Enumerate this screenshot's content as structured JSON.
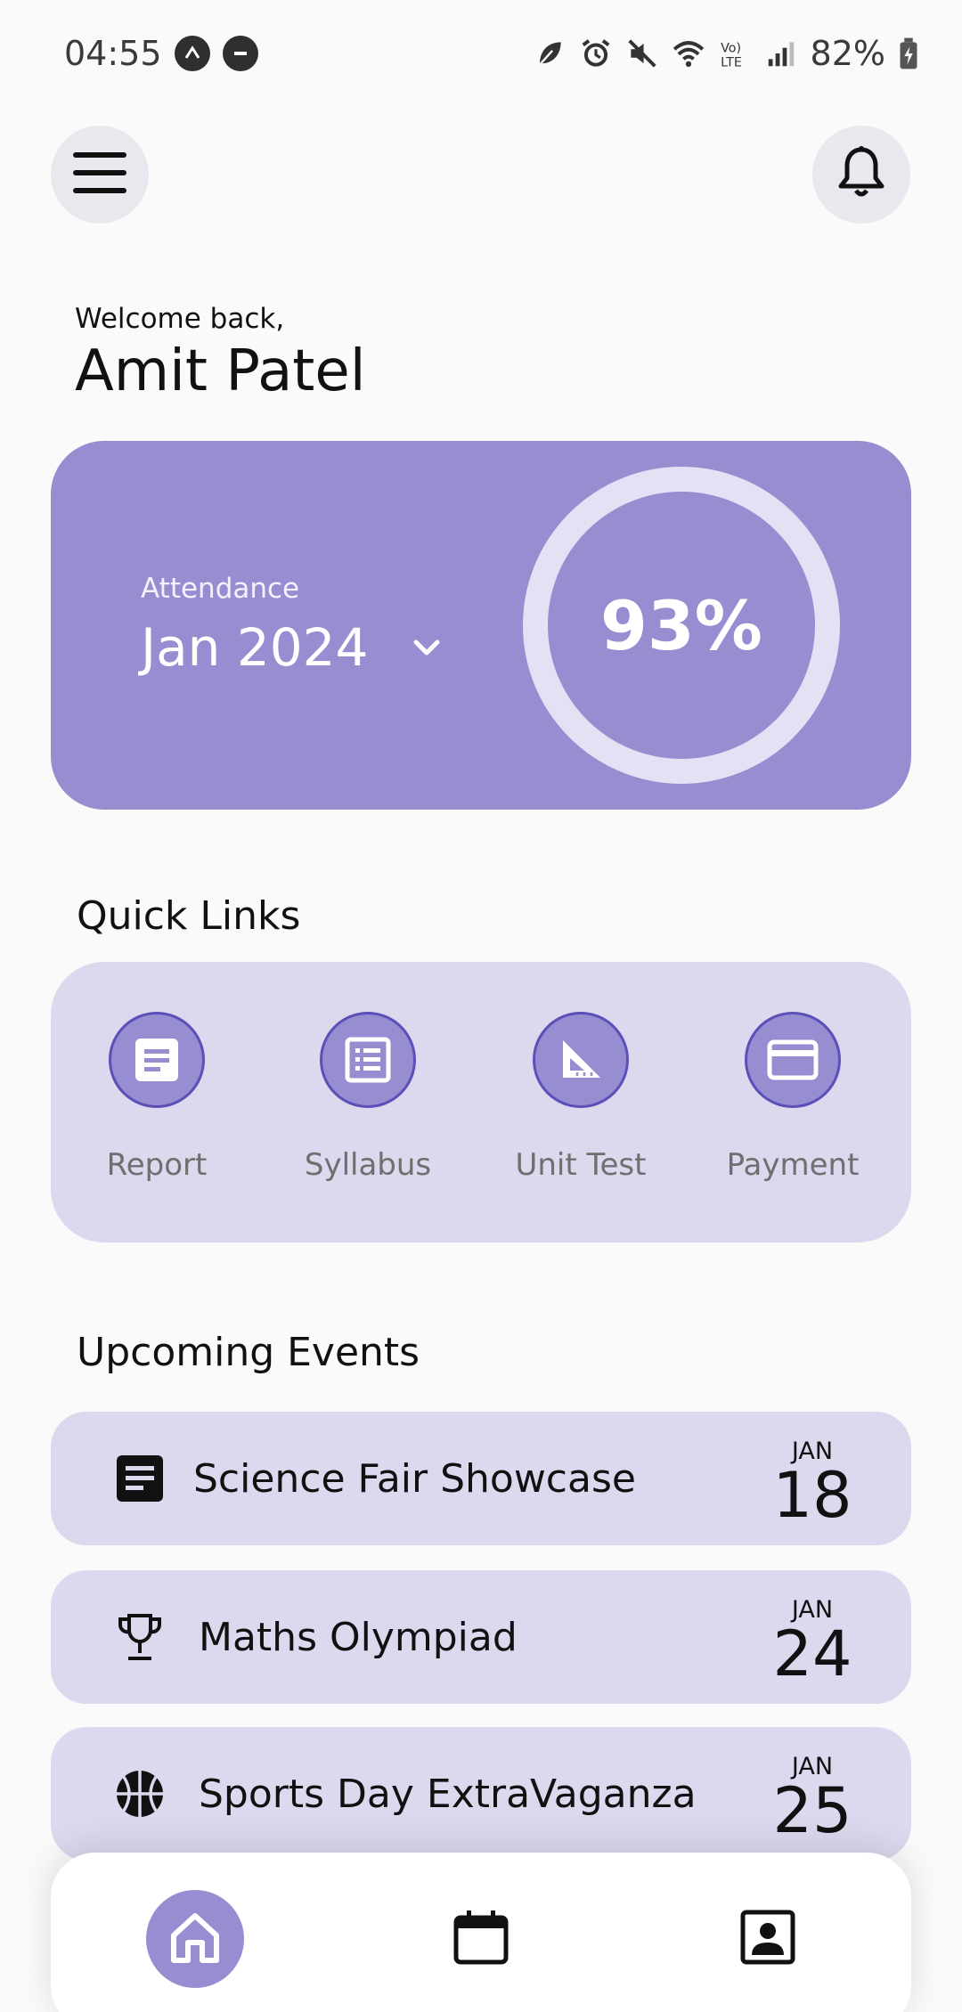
{
  "status_bar": {
    "time": "04:55",
    "battery": "82%",
    "left_icons": [
      "navigation-badge-icon",
      "do-not-disturb-icon"
    ],
    "right_icons": [
      "leaf-icon",
      "alarm-icon",
      "mute-icon",
      "wifi-icon",
      "volte-icon",
      "signal-icon",
      "battery-icon"
    ]
  },
  "header": {
    "menu_icon": "hamburger-menu-icon",
    "notification_icon": "bell-icon"
  },
  "greeting": {
    "welcome": "Welcome back,",
    "name": "Amit Patel"
  },
  "attendance": {
    "label": "Attendance",
    "month": "Jan 2024",
    "percent_text": "93%",
    "percent": 93,
    "card_color": "#978dd1"
  },
  "quick_links": {
    "title": "Quick Links",
    "items": [
      {
        "label": "Report",
        "icon": "report-icon"
      },
      {
        "label": "Syllabus",
        "icon": "syllabus-icon"
      },
      {
        "label": "Unit Test",
        "icon": "set-square-icon"
      },
      {
        "label": "Payment",
        "icon": "credit-card-icon"
      }
    ]
  },
  "events": {
    "title": "Upcoming Events",
    "items": [
      {
        "title": "Science Fair Showcase",
        "month": "JAN",
        "day": "18",
        "icon": "document-icon"
      },
      {
        "title": "Maths Olympiad",
        "month": "JAN",
        "day": "24",
        "icon": "trophy-icon"
      },
      {
        "title": "Sports Day ExtraVaganza",
        "month": "JAN",
        "day": "25",
        "icon": "basketball-icon"
      }
    ]
  },
  "bottom_nav": {
    "items": [
      {
        "name": "home",
        "icon": "home-icon",
        "active": true
      },
      {
        "name": "calendar",
        "icon": "calendar-icon",
        "active": false
      },
      {
        "name": "profile",
        "icon": "contact-card-icon",
        "active": false
      }
    ]
  },
  "colors": {
    "accent": "#978dd1",
    "accent_dark": "#5b4fb8",
    "card_light": "#dcd8ee"
  }
}
